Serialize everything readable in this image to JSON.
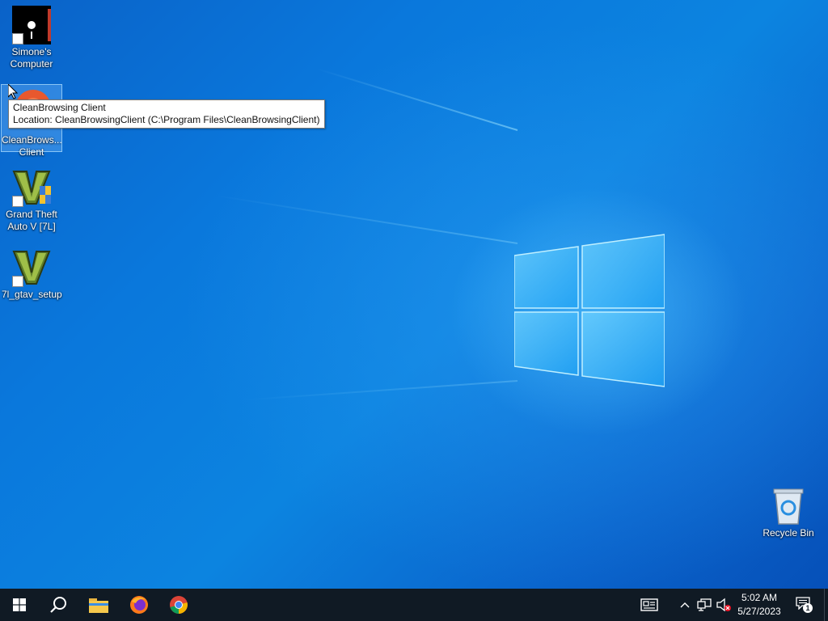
{
  "desktop": {
    "icons": [
      {
        "label_line1": "Simone's",
        "label_line2": "Computer",
        "icon": "computer-shortcut-icon"
      },
      {
        "label_line1": "CleanBrows...",
        "label_line2": "Client",
        "icon": "cleanbrowsing-icon"
      },
      {
        "label_line1": "Grand Theft",
        "label_line2": "Auto V [7L]",
        "icon": "gta-v-icon"
      },
      {
        "label_line1": "7l_gtav_setup",
        "label_line2": "",
        "icon": "gta-v-setup-icon"
      }
    ],
    "recycle_bin": {
      "label": "Recycle Bin",
      "icon": "recycle-bin-icon"
    }
  },
  "tooltip": {
    "line1": "CleanBrowsing Client",
    "line2": "Location: CleanBrowsingClient (C:\\Program Files\\CleanBrowsingClient)"
  },
  "taskbar": {
    "buttons": [
      "start-icon",
      "search-icon",
      "file-explorer-icon",
      "firefox-icon",
      "chrome-icon"
    ],
    "tray": [
      "news-widget-icon",
      "chevron-up-icon",
      "network-icon",
      "volume-muted-icon"
    ],
    "clock": {
      "time": "5:02 AM",
      "date": "5/27/2023"
    },
    "notifications": {
      "count": "1"
    }
  },
  "colors": {
    "taskbar": "#101a24",
    "desktop_accent": "#0a78dc"
  }
}
